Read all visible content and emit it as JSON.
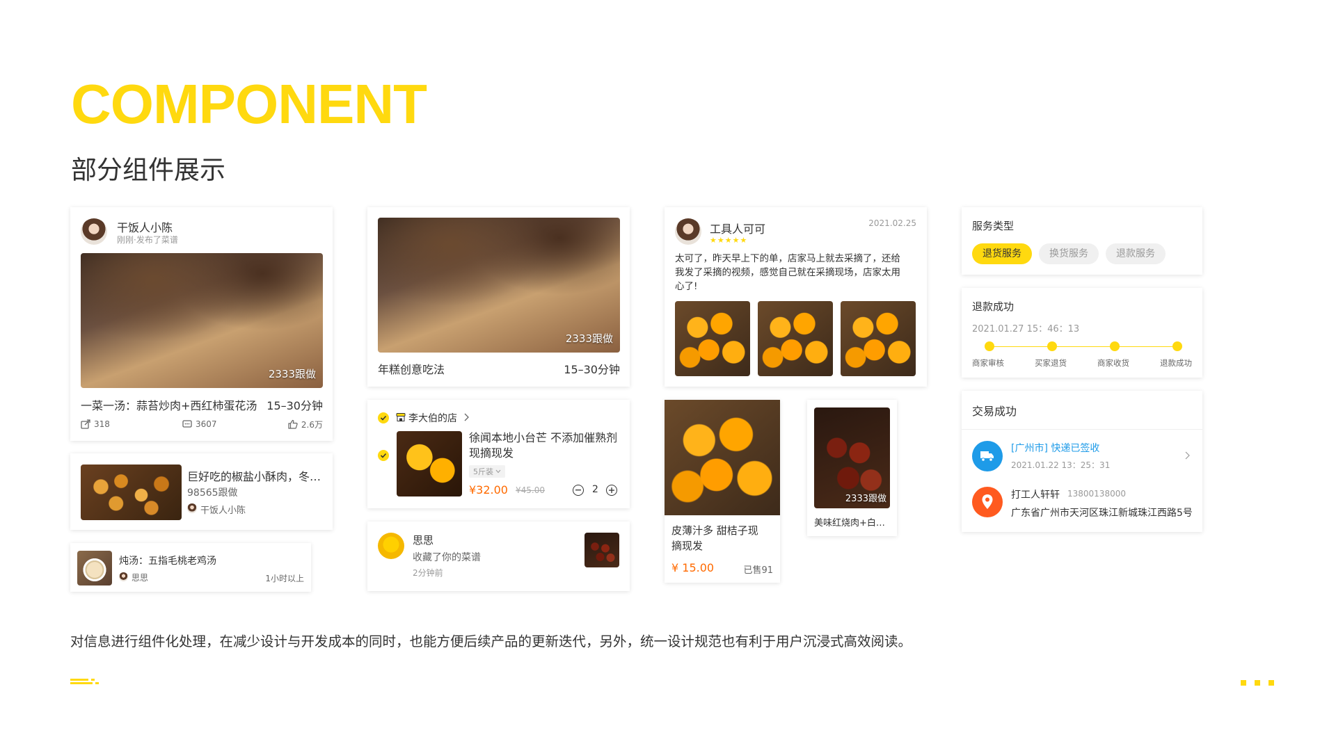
{
  "header": {
    "title": "COMPONENT",
    "subtitle": "部分组件展示"
  },
  "recipe_card": {
    "user": "干饭人小陈",
    "meta": "刚刚·发布了菜谱",
    "overlay": "2333跟做",
    "title": "一菜一汤：蒜苔炒肉+西红柿蛋花汤",
    "time": "15–30分钟",
    "shares": "318",
    "comments": "3607",
    "likes": "2.6万"
  },
  "list_card": {
    "title": "巨好吃的椒盐小酥肉，冬…",
    "follows": "98565跟做",
    "user": "干饭人小陈"
  },
  "small_card": {
    "title": "炖汤：五指毛桃老鸡汤",
    "user": "思思",
    "time": "1小时以上"
  },
  "big_card": {
    "overlay": "2333跟做",
    "title": "年糕创意吃法",
    "time": "15–30分钟"
  },
  "cart_card": {
    "store": "李大伯的店",
    "product": "徐闻本地小台芒 不添加催熟剂现摘现发",
    "spec": "5斤装",
    "price": "¥32.00",
    "original_price": "¥45.00",
    "quantity": "2"
  },
  "notify_card": {
    "user": "思思",
    "action": "收藏了你的菜谱",
    "time": "2分钟前"
  },
  "review_card": {
    "user": "工具人可可",
    "date": "2021.02.25",
    "stars": "★★★★★",
    "rating": 5,
    "text_lines": [
      "太可了，昨天早上下的单，店家马上就去采摘了，还给",
      "我发了采摘的视频，感觉自己就在采摘现场，店家太用",
      "心了!"
    ]
  },
  "product_card": {
    "title_lines": [
      "皮薄汁多 甜桔子现",
      "摘现发"
    ],
    "price": "¥ 15.00",
    "sold": "已售91"
  },
  "video_card": {
    "overlay": "2333跟做",
    "title": "美味红烧肉+白…"
  },
  "service_card": {
    "title": "服务类型",
    "options": [
      "退货服务",
      "换货服务",
      "退款服务"
    ],
    "selected": "退货服务"
  },
  "refund_card": {
    "title": "退款成功",
    "datetime": "2021.01.27  15：46：13",
    "steps": [
      "商家审核",
      "买家退货",
      "商家收货",
      "退款成功"
    ]
  },
  "trade_card": {
    "title": "交易成功",
    "logistics": "[广州市] 快递已签收",
    "logistics_time": "2021.01.22  13：25：31",
    "receiver": "打工人轩轩",
    "phone": "13800138000",
    "address": "广东省广州市天河区珠江新城珠江西路5号"
  },
  "footer": {
    "description": "对信息进行组件化处理，在减少设计与开发成本的同时，也能方便后续产品的更新迭代，另外，统一设计规范也有利于用户沉浸式高效阅读。"
  },
  "colors": {
    "accent": "#ffd90f",
    "price": "#ff6a00",
    "link": "#1e9be8",
    "location": "#ff5a1f"
  }
}
